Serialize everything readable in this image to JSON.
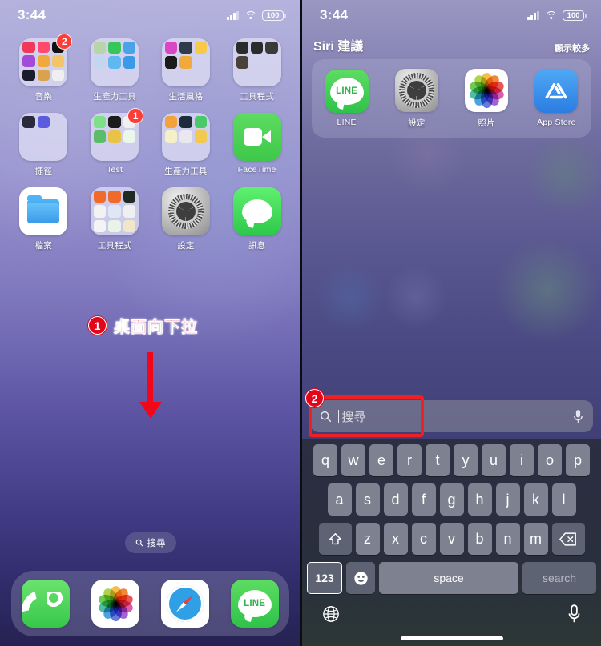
{
  "left_phone": {
    "status_bar": {
      "time": "3:44",
      "battery": "100",
      "signal_icon": "cellular-bars-icon",
      "wifi_icon": "wifi-icon"
    },
    "home_grid": [
      {
        "label": "音樂",
        "type": "folder",
        "badge": "2",
        "minis": [
          "#f1375a",
          "#ff4a6e",
          "#111111",
          "#a14bd6",
          "#f0a93c",
          "#f2c56b",
          "#1b1b2e",
          "#d9a24c",
          "#efeff2",
          "",
          "",
          ""
        ]
      },
      {
        "label": "生產力工具",
        "type": "folder",
        "badge": "",
        "minis": [
          "#b6d5a8",
          "#35c759",
          "#4aa3e8",
          "#c3d6ef",
          "#5fb8f0",
          "#3a9ae8",
          "",
          "",
          ""
        ]
      },
      {
        "label": "生活風格",
        "type": "folder",
        "badge": "",
        "minis": [
          "#d946c6",
          "#2f3b4a",
          "#f7c948",
          "#1b1b1b",
          "#f0a93c",
          "",
          "",
          "",
          ""
        ]
      },
      {
        "label": "工具程式",
        "type": "folder",
        "badge": "",
        "minis": [
          "#2b2b2b",
          "#2b2b2b",
          "#3a3a3a",
          "#4a4238",
          "",
          "",
          "",
          "",
          ""
        ]
      },
      {
        "label": "捷徑",
        "type": "folder",
        "badge": "",
        "minis": [
          "#2a2a3c",
          "#5b5be0",
          "",
          "",
          "",
          "",
          "",
          "",
          ""
        ]
      },
      {
        "label": "Test",
        "type": "folder",
        "badge": "1",
        "minis": [
          "#7fe08a",
          "#1c1c1c",
          "#f0f0f0",
          "#5bbd6a",
          "#e8c34a",
          "#eaf7ea",
          "",
          "",
          ""
        ]
      },
      {
        "label": "生產力工具",
        "type": "folder",
        "badge": "",
        "minis": [
          "#f2a33c",
          "#1d2b3a",
          "#49c96a",
          "#f5f0c8",
          "#e8e8ee",
          "#f2c94c",
          "",
          "",
          ""
        ]
      },
      {
        "label": "FaceTime",
        "type": "app",
        "icon": "facetime-icon",
        "badge": ""
      },
      {
        "label": "檔案",
        "type": "app",
        "icon": "files-icon",
        "badge": ""
      },
      {
        "label": "工具程式",
        "type": "folder",
        "badge": "",
        "minis": [
          "#f06a2a",
          "#f06a2a",
          "#1f2a24",
          "#f2f2f2",
          "#dfe7f5",
          "#efefef",
          "#f4f4f4",
          "#eaf3ea",
          "#f0e6c8"
        ]
      },
      {
        "label": "設定",
        "type": "app",
        "icon": "settings-gear-icon",
        "badge": ""
      },
      {
        "label": "訊息",
        "type": "app",
        "icon": "messages-icon",
        "badge": ""
      }
    ],
    "search_pill": {
      "label": "搜尋",
      "icon": "search-icon"
    },
    "dock": [
      {
        "label": "Phone",
        "icon": "phone-icon"
      },
      {
        "label": "Photos",
        "icon": "photos-icon"
      },
      {
        "label": "Safari",
        "icon": "safari-icon"
      },
      {
        "label": "LINE",
        "icon": "line-icon",
        "text": "LINE"
      }
    ],
    "annotation": {
      "number": "1",
      "text": "桌面向下拉",
      "arrow": "down-arrow-icon",
      "color": "#f50d1d"
    }
  },
  "right_phone": {
    "status_bar": {
      "time": "3:44",
      "battery": "100"
    },
    "siri": {
      "title": "Siri 建議",
      "more_label": "顯示較多",
      "suggestions": [
        {
          "label": "LINE",
          "icon": "line-icon",
          "text": "LINE"
        },
        {
          "label": "設定",
          "icon": "settings-gear-icon"
        },
        {
          "label": "照片",
          "icon": "photos-icon"
        },
        {
          "label": "App Store",
          "icon": "app-store-icon"
        }
      ]
    },
    "search_bar": {
      "placeholder": "搜尋",
      "icon": "search-icon",
      "mic_icon": "microphone-icon"
    },
    "annotation": {
      "number": "2",
      "color": "#ef1f22"
    },
    "keyboard": {
      "row1": [
        "q",
        "w",
        "e",
        "r",
        "t",
        "y",
        "u",
        "i",
        "o",
        "p"
      ],
      "row2": [
        "a",
        "s",
        "d",
        "f",
        "g",
        "h",
        "j",
        "k",
        "l"
      ],
      "row3": [
        "z",
        "x",
        "c",
        "v",
        "b",
        "n",
        "m"
      ],
      "shift_icon": "shift-up-arrow-icon",
      "backspace_icon": "backspace-icon",
      "numbers_label": "123",
      "emoji_icon": "emoji-smiley-icon",
      "space_label": "space",
      "return_label": "search",
      "globe_icon": "globe-icon",
      "dictation_icon": "microphone-icon"
    }
  }
}
